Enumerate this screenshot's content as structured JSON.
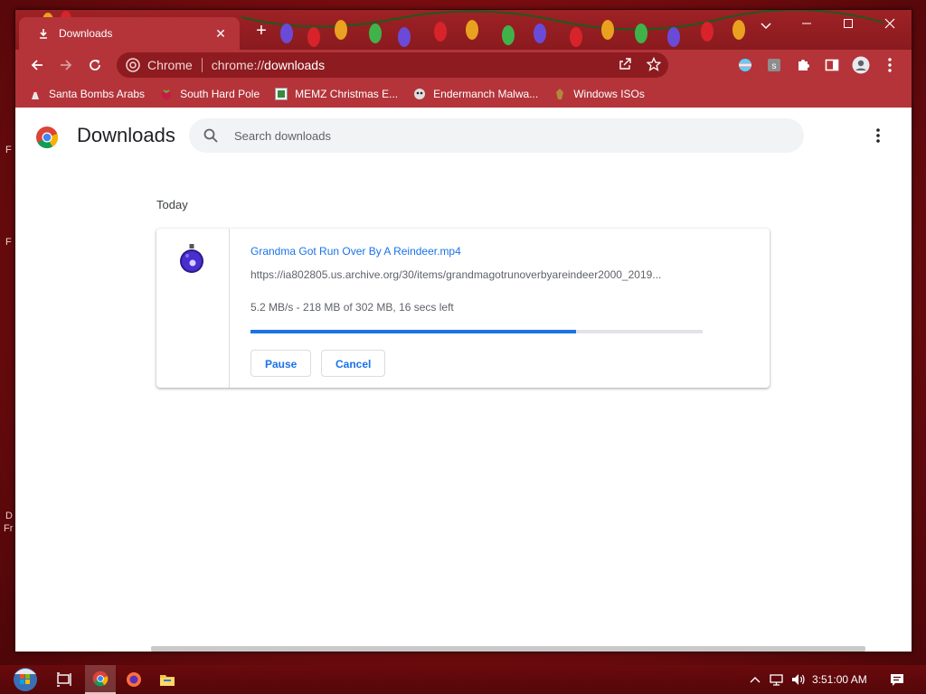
{
  "desktop": {
    "fragments": [
      "F",
      "F",
      "D",
      "Fr"
    ]
  },
  "browser": {
    "tab": {
      "title": "Downloads",
      "icon": "download-icon",
      "close_icon": "close-icon"
    },
    "new_tab_icon": "plus-icon",
    "window_controls": [
      "chevron-down-icon",
      "minimize-icon",
      "maximize-icon",
      "close-icon"
    ],
    "omnibox": {
      "site_label": "Chrome",
      "url_scheme": "chrome://",
      "url_host": "downloads"
    },
    "toolbar_icons": [
      "back-arrow-icon",
      "forward-arrow-icon",
      "reload-icon",
      "share-icon",
      "star-icon",
      "flag-extension-icon",
      "s-extension-icon",
      "puzzle-icon",
      "side-panel-icon",
      "profile-icon",
      "kebab-menu-icon"
    ],
    "bookmarks": [
      {
        "label": "Santa Bombs Arabs",
        "icon": "santa-icon"
      },
      {
        "label": "South Hard Pole",
        "icon": "raspberry-icon"
      },
      {
        "label": "MEMZ Christmas E...",
        "icon": "memz-icon"
      },
      {
        "label": "Endermanch Malwa...",
        "icon": "endermanch-icon"
      },
      {
        "label": "Windows ISOs",
        "icon": "windows-iso-icon"
      }
    ]
  },
  "downloads_page": {
    "title": "Downloads",
    "search_placeholder": "Search downloads",
    "section_date": "Today",
    "item": {
      "file_name": "Grandma Got Run Over By A Reindeer.mp4",
      "url": "https://ia802805.us.archive.org/30/items/grandmagotrunoverbyareindeer2000_2019...",
      "status": "5.2 MB/s - 218 MB of 302 MB, 16 secs left",
      "progress_fraction": 0.72,
      "pause_label": "Pause",
      "cancel_label": "Cancel",
      "file_icon": "ornament-bomb-icon"
    }
  },
  "taskbar": {
    "items": [
      "start-orb-icon",
      "task-view-icon",
      "chrome-icon",
      "firefox-icon",
      "file-explorer-icon"
    ],
    "tray_icons": [
      "chevron-up-icon",
      "network-icon",
      "volume-icon"
    ],
    "clock": "3:51:00 AM",
    "notification_icon": "notification-icon"
  },
  "colors": {
    "accent": "#1a73e8",
    "titlebar": "#9e2226",
    "toolbar": "#b4343a"
  }
}
